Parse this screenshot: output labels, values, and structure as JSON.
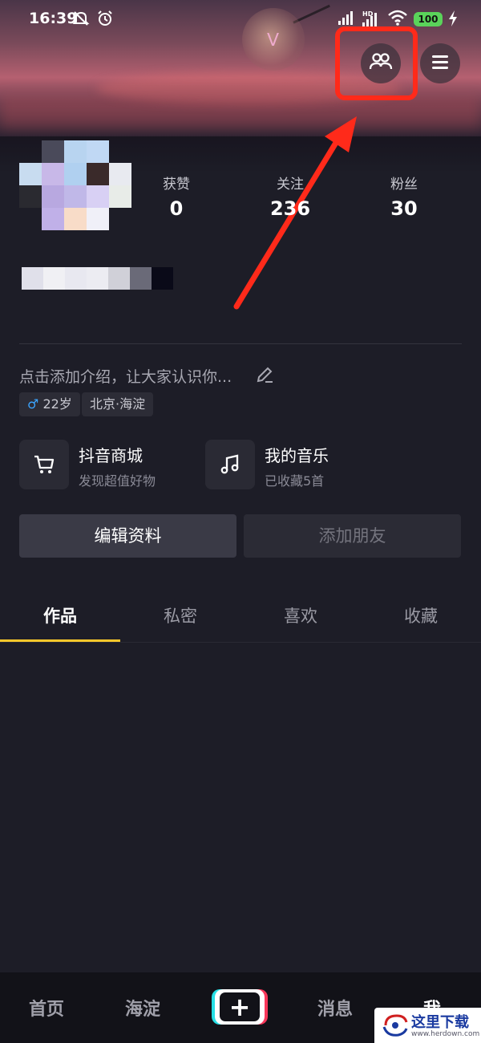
{
  "status_bar": {
    "time": "16:39",
    "battery": "100",
    "icons": [
      "mute-bell-icon",
      "alarm-icon",
      "signal-icon",
      "hd-signal-icon",
      "wifi-icon",
      "battery-icon",
      "charging-icon"
    ]
  },
  "header": {
    "friends_icon": "friends-icon",
    "menu_icon": "menu-icon",
    "highlight_color": "#ff2a1a"
  },
  "profile": {
    "stats": [
      {
        "label": "获赞",
        "value": "0"
      },
      {
        "label": "关注",
        "value": "236"
      },
      {
        "label": "粉丝",
        "value": "30"
      }
    ],
    "bio": "点击添加介绍，让大家认识你...",
    "tags": {
      "gender_symbol": "♂",
      "age": "22岁",
      "location": "北京·海淀"
    }
  },
  "shortcuts": [
    {
      "icon": "cart-icon",
      "title": "抖音商城",
      "subtitle": "发现超值好物"
    },
    {
      "icon": "music-note-icon",
      "title": "我的音乐",
      "subtitle": "已收藏5首"
    }
  ],
  "buttons": {
    "edit_profile": "编辑资料",
    "add_friends": "添加朋友"
  },
  "tabs": [
    "作品",
    "私密",
    "喜欢",
    "收藏"
  ],
  "active_tab": "作品",
  "bottom_nav": {
    "items": [
      "首页",
      "海淀",
      "消息",
      "我"
    ],
    "plus": "+"
  },
  "colors": {
    "background": "#1d1d27",
    "accent_underline": "#f9c82b",
    "gender_blue": "#3ba5ff"
  },
  "watermark": {
    "text": "这里下载",
    "url": "www.herdown.com"
  }
}
